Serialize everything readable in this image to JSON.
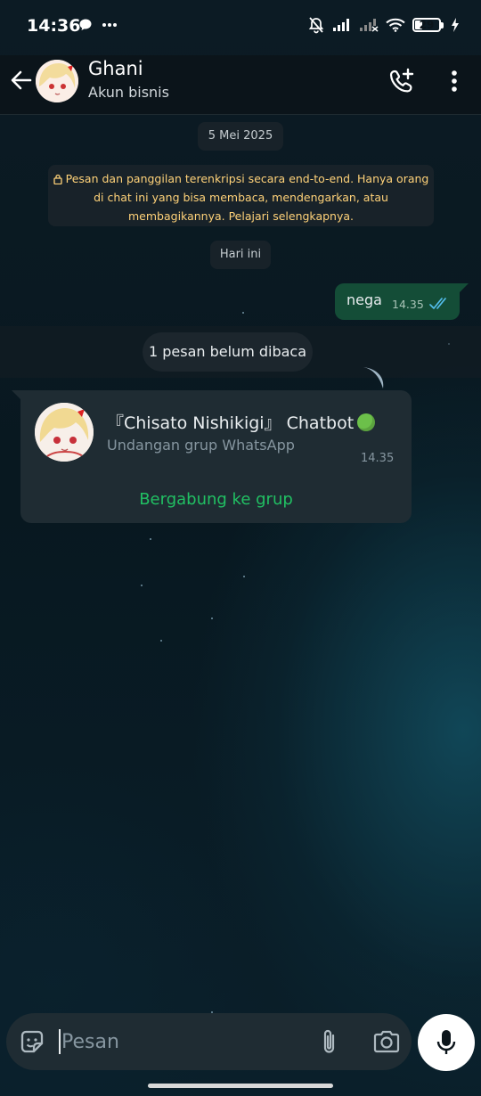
{
  "status_bar": {
    "time": "14:36",
    "battery": "29",
    "icons": [
      "chat-bubble-icon",
      "more-dots-icon",
      "mute-bell-icon",
      "signal-icon",
      "signal-no-service-icon",
      "wifi-icon",
      "battery-icon",
      "charging-icon"
    ]
  },
  "header": {
    "contact_name": "Ghani",
    "contact_subtitle": "Akun bisnis",
    "icons": [
      "back-arrow-icon",
      "add-call-icon",
      "more-vertical-icon"
    ]
  },
  "chat": {
    "date_chip": "5 Mei 2025",
    "encryption_notice": "Pesan dan panggilan terenkripsi secara end-to-end. Hanya orang di chat ini yang bisa membaca, mendengarkan, atau membagikannya. Pelajari selengkapnya.",
    "today_chip": "Hari ini",
    "outgoing_message": {
      "text": "nega",
      "time": "14.35",
      "status": "read"
    },
    "unread_banner": "1 pesan belum dibaca",
    "group_invite": {
      "group_name": "『Chisato Nishikigi』 Chatbot",
      "subtitle": "Undangan grup WhatsApp",
      "time": "14.35",
      "action": "Bergabung ke grup"
    }
  },
  "composer": {
    "placeholder": "Pesan",
    "icons": [
      "sticker-icon",
      "paperclip-icon",
      "camera-icon",
      "microphone-icon"
    ]
  },
  "colors": {
    "background": "#0b141a",
    "outgoing_bubble": "#144d37",
    "incoming_bubble": "#1f2c33",
    "accent_green": "#21c063",
    "notice_text": "#ffd279",
    "read_ticks": "#53bdeb"
  }
}
